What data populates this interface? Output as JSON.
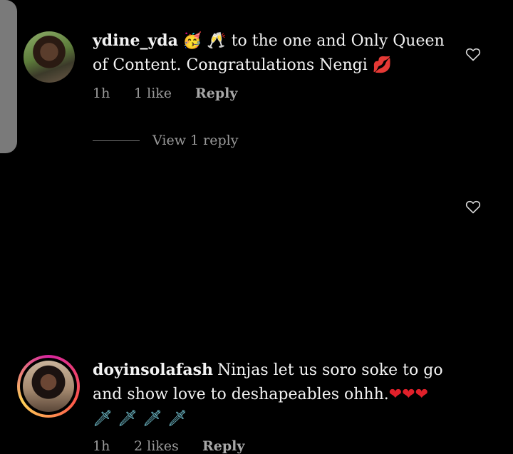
{
  "comments": [
    {
      "username": "ydine_yda",
      "emoji_prefix": "🥳 🥂",
      "text": " to the one and Only Queen of Content. Congratulations Nengi ",
      "emoji_suffix": "💋",
      "time": "1h",
      "likes": "1 like",
      "reply_label": "Reply"
    },
    {
      "username": "doyinsolafash",
      "text": "Ninjas let us soro soke to go and show love to deshapeables ohhh.",
      "hearts": "❤❤❤",
      "daggers": "🗡 🗡 🗡 🗡",
      "time": "1h",
      "likes": "2 likes",
      "reply_label": "Reply"
    }
  ],
  "view_replies_label": "View 1 reply",
  "icons": {
    "like": "heart-outline-icon"
  },
  "colors": {
    "background": "#000000",
    "text": "#f2f2f2",
    "meta": "#9a9a9a",
    "story_ring": "#d6249f"
  }
}
